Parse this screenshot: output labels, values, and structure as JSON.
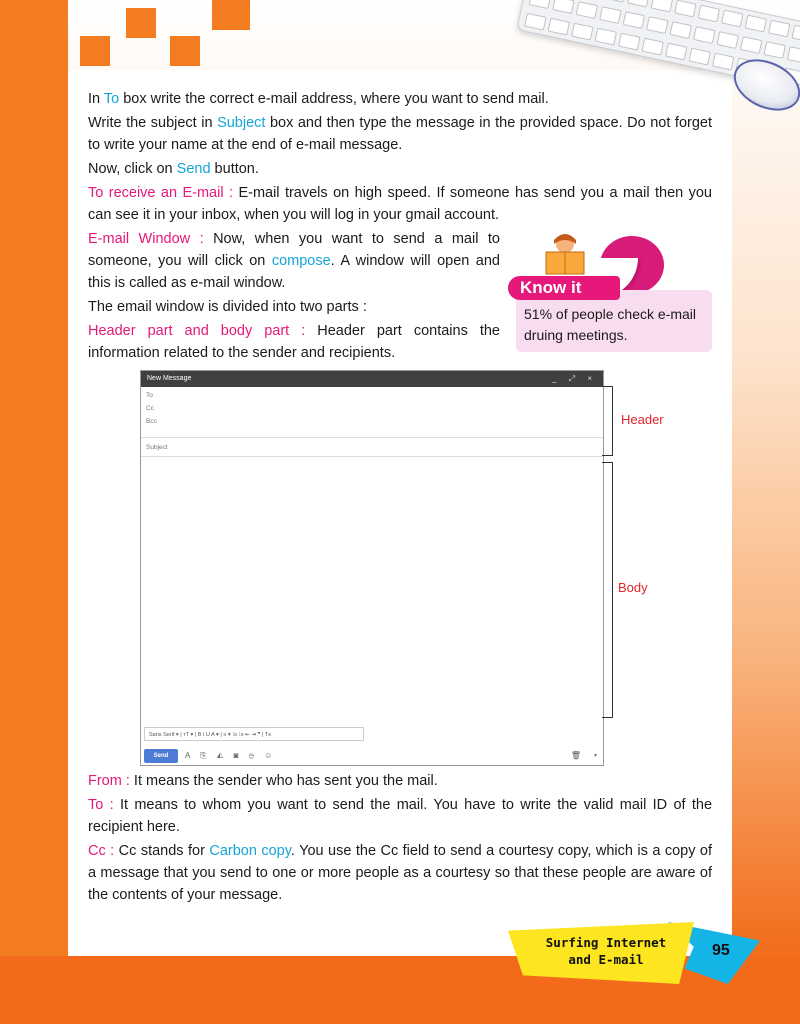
{
  "paragraphs": {
    "p1": {
      "a": "In ",
      "b": "To",
      "c": " box write the correct e-mail address, where you want to send mail."
    },
    "p2": {
      "a": "Write the subject in ",
      "b": "Subject",
      "c": " box and then type the message in the provided space. Do not forget to write your name at the end of e-mail message."
    },
    "p3": {
      "a": "Now, click on ",
      "b": "Send",
      "c": " button."
    },
    "p4": {
      "head": "To receive an E-mail :",
      "body": " E-mail travels on high speed. If someone has send you a mail then you can see it in your inbox, when you will log in your gmail account."
    },
    "p5": {
      "head": "E-mail Window :",
      "a": " Now, when you want to send a mail to someone, you will click on ",
      "b": "compose",
      "c": ". A window will open and this is called as e-mail window."
    },
    "p6": {
      "text": "The email window is divided into two parts :"
    },
    "p7": {
      "head": "Header part and body part :",
      "body": " Header part contains the information related to the sender and recipients."
    },
    "p8": {
      "head": "From :",
      "body": " It means the sender who has sent you the mail."
    },
    "p9": {
      "head": "To :",
      "body": " It means to whom you want to send the mail. You have to write the valid mail ID of the recipient here."
    },
    "p10": {
      "head": "Cc :",
      "a": " Cc stands for ",
      "b": "Carbon copy",
      "c": ". You use the Cc field to send a courtesy copy, which is a copy of a message that you send to one or more people as a courtesy so that these people are aware of the contents of your message."
    }
  },
  "know_it": {
    "tab": "Know it",
    "text": "51% of people check e-mail druing meetings."
  },
  "email_window": {
    "title": "New Message",
    "controls": "_ ⤢ ×",
    "fields": [
      "To",
      "Cc",
      "Bcc"
    ],
    "subject": "Subject",
    "format_bar": "Sans Serif  ▾  | тT ▾ |  B  I  U  A ▾ |  ≡ ▾  ⁝≡  ⁝≡  ⇤  ⇥  ❞  |  Tx",
    "send": "Send",
    "send_icons": "A ⎘ ◭ ◙ ⊖ ☺"
  },
  "labels": {
    "header": "Header",
    "body": "Body"
  },
  "footer": {
    "chapter": "Surfing Internet and E-mail",
    "page": "95"
  },
  "colors": {
    "accent_blue": "#14a5d8",
    "accent_pink": "#e6197a",
    "orange": "#f47c20",
    "label_red": "#e0262b"
  }
}
